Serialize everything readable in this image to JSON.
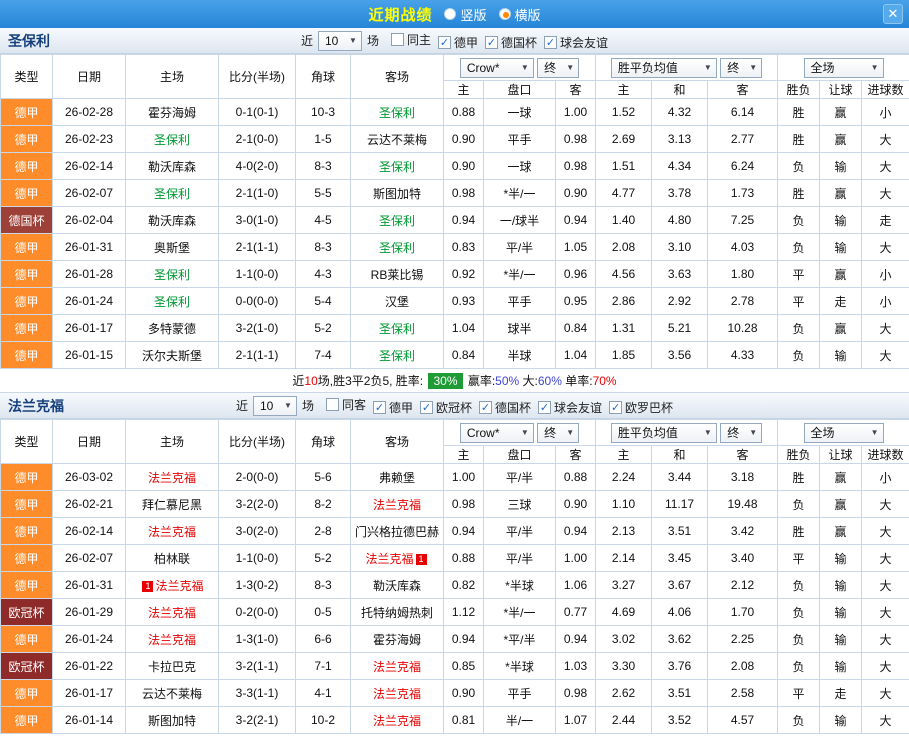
{
  "colors": {
    "titlebar": "#2585d6",
    "title_text": "#ffff00",
    "border": "#c9d7e6",
    "red": "#e80000",
    "green": "#009933",
    "blue": "#3d46cc",
    "badge_green": "#1f9b35",
    "league_dejia": "#ff8c2a",
    "league_deguobei": "#9d4038",
    "league_ouguanbei": "#8f2a2a"
  },
  "titlebar": {
    "title": "近期战绩",
    "vertical": "竖版",
    "horizontal": "横版",
    "close": "✕"
  },
  "cols": [
    "类型",
    "日期",
    "主场",
    "比分(半场)",
    "角球",
    "客场",
    "主",
    "盘口",
    "客",
    "主",
    "和",
    "客",
    "胜负",
    "让球",
    "进球数"
  ],
  "sections": [
    {
      "team": "圣保利",
      "tracked_color": "#009933",
      "near": "近",
      "count": "10",
      "games": "场",
      "filters": [
        {
          "label": "同主",
          "checked": false
        },
        {
          "label": "德甲",
          "checked": true
        },
        {
          "label": "德国杯",
          "checked": true
        },
        {
          "label": "球会友谊",
          "checked": true
        }
      ],
      "selects": {
        "company": "Crow*",
        "t1": "终",
        "avg": "胜平负均值",
        "t2": "终",
        "scope": "全场"
      },
      "rows": [
        {
          "lg": "德甲",
          "lk": "dejia",
          "date": "26-02-28",
          "h": "霍芬海姆",
          "ht": false,
          "hb": "",
          "score": "0-1(0-1)",
          "cn": "10-3",
          "a": "圣保利",
          "at": true,
          "ab": "",
          "o1": "0.88",
          "hc": "一球",
          "hs": false,
          "o2": "1.00",
          "m": "1.52",
          "d": "4.32",
          "g": "6.14",
          "r1": {
            "t": "胜",
            "c": "R"
          },
          "r2": {
            "t": "赢",
            "c": "R"
          },
          "r3": {
            "t": "小",
            "c": "R"
          }
        },
        {
          "lg": "德甲",
          "lk": "dejia",
          "date": "26-02-23",
          "h": "圣保利",
          "ht": true,
          "hb": "",
          "score": "2-1(0-0)",
          "cn": "1-5",
          "a": "云达不莱梅",
          "at": false,
          "ab": "",
          "o1": "0.90",
          "hc": "平手",
          "hs": false,
          "o2": "0.98",
          "m": "2.69",
          "d": "3.13",
          "g": "2.77",
          "r1": {
            "t": "胜",
            "c": "R"
          },
          "r2": {
            "t": "赢",
            "c": "R"
          },
          "r3": {
            "t": "大",
            "c": "R"
          }
        },
        {
          "lg": "德甲",
          "lk": "dejia",
          "date": "26-02-14",
          "h": "勒沃库森",
          "ht": false,
          "hb": "",
          "score": "4-0(2-0)",
          "cn": "8-3",
          "a": "圣保利",
          "at": true,
          "ab": "",
          "o1": "0.90",
          "hc": "一球",
          "hs": false,
          "o2": "0.98",
          "m": "1.51",
          "d": "4.34",
          "g": "6.24",
          "r1": {
            "t": "负",
            "c": "G"
          },
          "r2": {
            "t": "输",
            "c": "G"
          },
          "r3": {
            "t": "大",
            "c": "R"
          }
        },
        {
          "lg": "德甲",
          "lk": "dejia",
          "date": "26-02-07",
          "h": "圣保利",
          "ht": true,
          "hb": "",
          "score": "2-1(1-0)",
          "cn": "5-5",
          "a": "斯图加特",
          "at": false,
          "ab": "",
          "o1": "0.98",
          "hc": "*半/一",
          "hs": true,
          "o2": "0.90",
          "m": "4.77",
          "d": "3.78",
          "g": "1.73",
          "r1": {
            "t": "胜",
            "c": "R"
          },
          "r2": {
            "t": "赢",
            "c": "R"
          },
          "r3": {
            "t": "大",
            "c": "R"
          }
        },
        {
          "lg": "德国杯",
          "lk": "deguobei",
          "date": "26-02-04",
          "h": "勒沃库森",
          "ht": false,
          "hb": "",
          "score": "3-0(1-0)",
          "cn": "4-5",
          "a": "圣保利",
          "at": true,
          "ab": "",
          "o1": "0.94",
          "hc": "一/球半",
          "hs": false,
          "o2": "0.94",
          "m": "1.40",
          "d": "4.80",
          "g": "7.25",
          "r1": {
            "t": "负",
            "c": "G"
          },
          "r2": {
            "t": "输",
            "c": "G"
          },
          "r3": {
            "t": "走",
            "c": "B"
          }
        },
        {
          "lg": "德甲",
          "lk": "dejia",
          "date": "26-01-31",
          "h": "奥斯堡",
          "ht": false,
          "hb": "",
          "score": "2-1(1-1)",
          "cn": "8-3",
          "a": "圣保利",
          "at": true,
          "ab": "",
          "o1": "0.83",
          "hc": "平/半",
          "hs": false,
          "o2": "1.05",
          "m": "2.08",
          "d": "3.10",
          "g": "4.03",
          "r1": {
            "t": "负",
            "c": "G"
          },
          "r2": {
            "t": "输",
            "c": "G"
          },
          "r3": {
            "t": "大",
            "c": "R"
          }
        },
        {
          "lg": "德甲",
          "lk": "dejia",
          "date": "26-01-28",
          "h": "圣保利",
          "ht": true,
          "hb": "",
          "score": "1-1(0-0)",
          "cn": "4-3",
          "a": "RB莱比锡",
          "at": false,
          "ab": "",
          "o1": "0.92",
          "hc": "*半/一",
          "hs": true,
          "o2": "0.96",
          "m": "4.56",
          "d": "3.63",
          "g": "1.80",
          "r1": {
            "t": "平",
            "c": "B"
          },
          "r2": {
            "t": "赢",
            "c": "R"
          },
          "r3": {
            "t": "小",
            "c": "R"
          }
        },
        {
          "lg": "德甲",
          "lk": "dejia",
          "date": "26-01-24",
          "h": "圣保利",
          "ht": true,
          "hb": "",
          "score": "0-0(0-0)",
          "cn": "5-4",
          "a": "汉堡",
          "at": false,
          "ab": "",
          "o1": "0.93",
          "hc": "平手",
          "hs": false,
          "o2": "0.95",
          "m": "2.86",
          "d": "2.92",
          "g": "2.78",
          "r1": {
            "t": "平",
            "c": "B"
          },
          "r2": {
            "t": "走",
            "c": "B"
          },
          "r3": {
            "t": "小",
            "c": "R"
          }
        },
        {
          "lg": "德甲",
          "lk": "dejia",
          "date": "26-01-17",
          "h": "多特蒙德",
          "ht": false,
          "hb": "",
          "score": "3-2(1-0)",
          "cn": "5-2",
          "a": "圣保利",
          "at": true,
          "ab": "",
          "o1": "1.04",
          "hc": "球半",
          "hs": false,
          "o2": "0.84",
          "m": "1.31",
          "d": "5.21",
          "g": "10.28",
          "r1": {
            "t": "负",
            "c": "G"
          },
          "r2": {
            "t": "赢",
            "c": "R"
          },
          "r3": {
            "t": "大",
            "c": "R"
          }
        },
        {
          "lg": "德甲",
          "lk": "dejia",
          "date": "26-01-15",
          "h": "沃尔夫斯堡",
          "ht": false,
          "hb": "",
          "score": "2-1(1-1)",
          "cn": "7-4",
          "a": "圣保利",
          "at": true,
          "ab": "",
          "o1": "0.84",
          "hc": "半球",
          "hs": false,
          "o2": "1.04",
          "m": "1.85",
          "d": "3.56",
          "g": "4.33",
          "r1": {
            "t": "负",
            "c": "G"
          },
          "r2": {
            "t": "输",
            "c": "G"
          },
          "r3": {
            "t": "大",
            "c": "R"
          }
        }
      ],
      "summary": [
        {
          "t": "近"
        },
        {
          "t": "10",
          "c": "R"
        },
        {
          "t": "场,胜3平2负5, 胜率: "
        },
        {
          "t": "30%",
          "badge": true
        },
        {
          "t": " 赢率:"
        },
        {
          "t": "50%",
          "c": "B"
        },
        {
          "t": " 大:"
        },
        {
          "t": "60%",
          "c": "B"
        },
        {
          "t": " 单率:"
        },
        {
          "t": "70%",
          "c": "R"
        }
      ]
    },
    {
      "team": "法兰克福",
      "tracked_color": "#e80000",
      "near": "近",
      "count": "10",
      "games": "场",
      "filters": [
        {
          "label": "同客",
          "checked": false
        },
        {
          "label": "德甲",
          "checked": true
        },
        {
          "label": "欧冠杯",
          "checked": true
        },
        {
          "label": "德国杯",
          "checked": true
        },
        {
          "label": "球会友谊",
          "checked": true
        },
        {
          "label": "欧罗巴杯",
          "checked": true
        }
      ],
      "selects": {
        "company": "Crow*",
        "t1": "终",
        "avg": "胜平负均值",
        "t2": "终",
        "scope": "全场"
      },
      "rows": [
        {
          "lg": "德甲",
          "lk": "dejia",
          "date": "26-03-02",
          "h": "法兰克福",
          "ht": true,
          "hb": "",
          "score": "2-0(0-0)",
          "cn": "5-6",
          "a": "弗赖堡",
          "at": false,
          "ab": "",
          "o1": "1.00",
          "hc": "平/半",
          "hs": false,
          "o2": "0.88",
          "m": "2.24",
          "d": "3.44",
          "g": "3.18",
          "r1": {
            "t": "胜",
            "c": "R"
          },
          "r2": {
            "t": "赢",
            "c": "R"
          },
          "r3": {
            "t": "小",
            "c": "R"
          }
        },
        {
          "lg": "德甲",
          "lk": "dejia",
          "date": "26-02-21",
          "h": "拜仁慕尼黑",
          "ht": false,
          "hb": "",
          "score": "3-2(2-0)",
          "cn": "8-2",
          "a": "法兰克福",
          "at": true,
          "ab": "",
          "o1": "0.98",
          "hc": "三球",
          "hs": false,
          "o2": "0.90",
          "m": "1.10",
          "d": "11.17",
          "g": "19.48",
          "r1": {
            "t": "负",
            "c": "G"
          },
          "r2": {
            "t": "赢",
            "c": "R"
          },
          "r3": {
            "t": "大",
            "c": "R"
          }
        },
        {
          "lg": "德甲",
          "lk": "dejia",
          "date": "26-02-14",
          "h": "法兰克福",
          "ht": true,
          "hb": "",
          "score": "3-0(2-0)",
          "cn": "2-8",
          "a": "门兴格拉德巴赫",
          "at": false,
          "ab": "",
          "o1": "0.94",
          "hc": "平/半",
          "hs": false,
          "o2": "0.94",
          "m": "2.13",
          "d": "3.51",
          "g": "3.42",
          "r1": {
            "t": "胜",
            "c": "R"
          },
          "r2": {
            "t": "赢",
            "c": "R"
          },
          "r3": {
            "t": "大",
            "c": "R"
          }
        },
        {
          "lg": "德甲",
          "lk": "dejia",
          "date": "26-02-07",
          "h": "柏林联",
          "ht": false,
          "hb": "",
          "score": "1-1(0-0)",
          "cn": "5-2",
          "a": "法兰克福",
          "at": true,
          "ab": "1",
          "o1": "0.88",
          "hc": "平/半",
          "hs": false,
          "o2": "1.00",
          "m": "2.14",
          "d": "3.45",
          "g": "3.40",
          "r1": {
            "t": "平",
            "c": "B"
          },
          "r2": {
            "t": "输",
            "c": "G"
          },
          "r3": {
            "t": "大",
            "c": "R"
          }
        },
        {
          "lg": "德甲",
          "lk": "dejia",
          "date": "26-01-31",
          "h": "法兰克福",
          "ht": true,
          "hb": "1",
          "score": "1-3(0-2)",
          "cn": "8-3",
          "a": "勒沃库森",
          "at": false,
          "ab": "",
          "o1": "0.82",
          "hc": "*半球",
          "hs": true,
          "o2": "1.06",
          "m": "3.27",
          "d": "3.67",
          "g": "2.12",
          "r1": {
            "t": "负",
            "c": "G"
          },
          "r2": {
            "t": "输",
            "c": "G"
          },
          "r3": {
            "t": "大",
            "c": "R"
          }
        },
        {
          "lg": "欧冠杯",
          "lk": "ouguanbei",
          "date": "26-01-29",
          "h": "法兰克福",
          "ht": true,
          "hb": "",
          "score": "0-2(0-0)",
          "cn": "0-5",
          "a": "托特纳姆热刺",
          "at": false,
          "ab": "",
          "o1": "1.12",
          "hc": "*半/一",
          "hs": true,
          "o2": "0.77",
          "m": "4.69",
          "d": "4.06",
          "g": "1.70",
          "r1": {
            "t": "负",
            "c": "G"
          },
          "r2": {
            "t": "输",
            "c": "G"
          },
          "r3": {
            "t": "大",
            "c": "R"
          }
        },
        {
          "lg": "德甲",
          "lk": "dejia",
          "date": "26-01-24",
          "h": "法兰克福",
          "ht": true,
          "hb": "",
          "score": "1-3(1-0)",
          "cn": "6-6",
          "a": "霍芬海姆",
          "at": false,
          "ab": "",
          "o1": "0.94",
          "hc": "*平/半",
          "hs": true,
          "o2": "0.94",
          "m": "3.02",
          "d": "3.62",
          "g": "2.25",
          "r1": {
            "t": "负",
            "c": "G"
          },
          "r2": {
            "t": "输",
            "c": "G"
          },
          "r3": {
            "t": "大",
            "c": "R"
          }
        },
        {
          "lg": "欧冠杯",
          "lk": "ouguanbei",
          "date": "26-01-22",
          "h": "卡拉巴克",
          "ht": false,
          "hb": "",
          "score": "3-2(1-1)",
          "cn": "7-1",
          "a": "法兰克福",
          "at": true,
          "ab": "",
          "o1": "0.85",
          "hc": "*半球",
          "hs": true,
          "o2": "1.03",
          "m": "3.30",
          "d": "3.76",
          "g": "2.08",
          "r1": {
            "t": "负",
            "c": "G"
          },
          "r2": {
            "t": "输",
            "c": "G"
          },
          "r3": {
            "t": "大",
            "c": "R"
          }
        },
        {
          "lg": "德甲",
          "lk": "dejia",
          "date": "26-01-17",
          "h": "云达不莱梅",
          "ht": false,
          "hb": "",
          "score": "3-3(1-1)",
          "cn": "4-1",
          "a": "法兰克福",
          "at": true,
          "ab": "",
          "o1": "0.90",
          "hc": "平手",
          "hs": false,
          "o2": "0.98",
          "m": "2.62",
          "d": "3.51",
          "g": "2.58",
          "r1": {
            "t": "平",
            "c": "B"
          },
          "r2": {
            "t": "走",
            "c": "B"
          },
          "r3": {
            "t": "大",
            "c": "R"
          }
        },
        {
          "lg": "德甲",
          "lk": "dejia",
          "date": "26-01-14",
          "h": "斯图加特",
          "ht": false,
          "hb": "",
          "score": "3-2(2-1)",
          "cn": "10-2",
          "a": "法兰克福",
          "at": true,
          "ab": "",
          "o1": "0.81",
          "hc": "半/一",
          "hs": false,
          "o2": "1.07",
          "m": "2.44",
          "d": "3.52",
          "g": "4.57",
          "r1": {
            "t": "负",
            "c": "G"
          },
          "r2": {
            "t": "输",
            "c": "G"
          },
          "r3": {
            "t": "大",
            "c": "R"
          }
        }
      ]
    }
  ]
}
